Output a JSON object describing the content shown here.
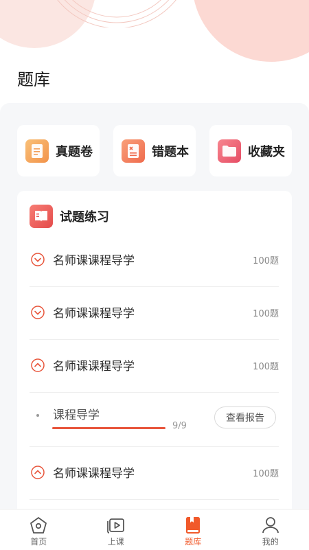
{
  "page": {
    "title": "题库"
  },
  "colors": {
    "accent": "#f1592a",
    "progress": "#e8553b"
  },
  "categories": [
    {
      "label": "真题卷",
      "icon": "exam-paper-icon"
    },
    {
      "label": "错题本",
      "icon": "wrong-questions-icon"
    },
    {
      "label": "收藏夹",
      "icon": "favorites-folder-icon"
    }
  ],
  "practice": {
    "title": "试题练习",
    "icon": "book-icon",
    "items": [
      {
        "name": "名师课课程导学",
        "count": "100题",
        "state": "collapsed"
      },
      {
        "name": "名师课课程导学",
        "count": "100题",
        "state": "collapsed"
      },
      {
        "name": "名师课课程导学",
        "count": "100题",
        "state": "expanded"
      },
      {
        "name": "名师课课程导学",
        "count": "100题",
        "state": "collapsed"
      }
    ],
    "sub_item": {
      "name": "课程导学",
      "progress_text": "9/9",
      "progress": 1.0,
      "button_label": "查看报告"
    }
  },
  "tabbar": {
    "items": [
      {
        "label": "首页",
        "icon": "home-icon",
        "active": false
      },
      {
        "label": "上课",
        "icon": "play-video-icon",
        "active": false
      },
      {
        "label": "题库",
        "icon": "question-bank-icon",
        "active": true
      },
      {
        "label": "我的",
        "icon": "user-profile-icon",
        "active": false
      }
    ]
  }
}
